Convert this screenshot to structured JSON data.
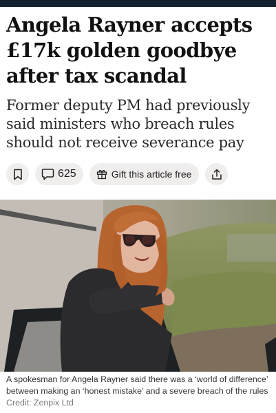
{
  "article": {
    "headline": "Angela Rayner accepts £17k golden goodbye after tax scandal",
    "standfirst": "Former deputy PM had previously said ministers who breach rules should not receive severance pay"
  },
  "actions": {
    "comment_count": "625",
    "gift_label": "Gift this article free",
    "icons": [
      "bookmark-icon",
      "comment-icon",
      "gift-icon",
      "share-icon"
    ]
  },
  "image": {
    "caption": "A spokesman for Angela Rayner said there was a ‘world of difference’ between making an ‘honest mistake’ and a severe breach of the rules",
    "credit": "Credit: Zenpix Ltd"
  },
  "colors": {
    "top_bar": "#13212e",
    "pill_background": "#f0eded",
    "headline_text": "#111111",
    "credit_text": "#777777"
  }
}
